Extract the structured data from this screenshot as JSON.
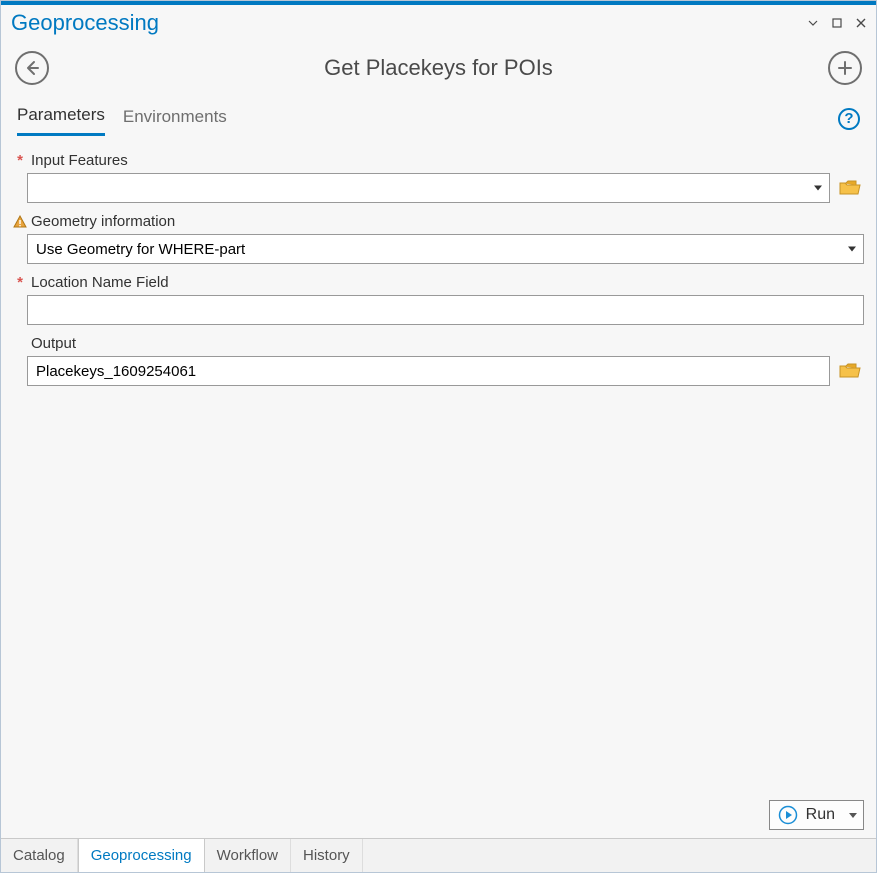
{
  "panel": {
    "title": "Geoprocessing"
  },
  "tool": {
    "title": "Get Placekeys for POIs"
  },
  "tabs": {
    "parameters": "Parameters",
    "environments": "Environments"
  },
  "params": {
    "input_features": {
      "label": "Input Features",
      "value": ""
    },
    "geometry_info": {
      "label": "Geometry information",
      "value": "Use Geometry for WHERE-part"
    },
    "location_name_field": {
      "label": "Location Name Field",
      "value": ""
    },
    "output": {
      "label": "Output",
      "value": "Placekeys_1609254061"
    }
  },
  "run": {
    "label": "Run"
  },
  "bottom_tabs": {
    "catalog": "Catalog",
    "geoprocessing": "Geoprocessing",
    "workflow": "Workflow",
    "history": "History"
  }
}
